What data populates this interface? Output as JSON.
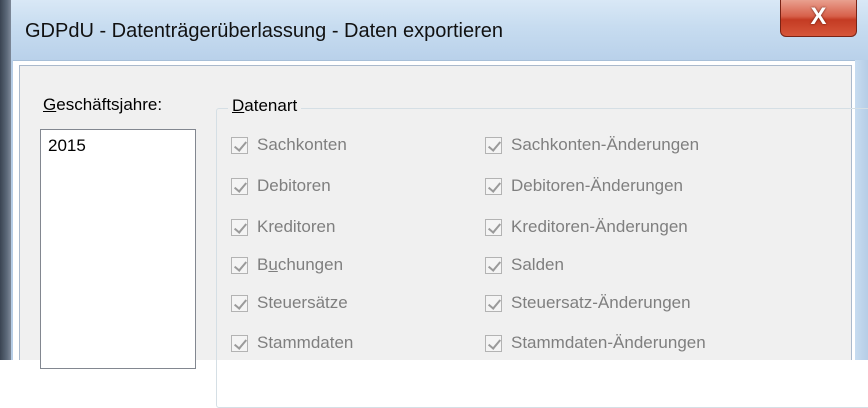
{
  "window": {
    "title": "GDPdU - Datenträgerüberlassung - Daten exportieren",
    "close_label": "X"
  },
  "years": {
    "label_accel": "G",
    "label_rest": "eschäftsjahre:",
    "items": [
      "2015"
    ]
  },
  "datenart": {
    "title_accel": "D",
    "title_rest": "atenart",
    "left": [
      {
        "label": "Sachkonten",
        "checked": true,
        "enabled": false
      },
      {
        "label": "Debitoren",
        "checked": true,
        "enabled": false
      },
      {
        "label": "Kreditoren",
        "checked": true,
        "enabled": false
      },
      {
        "label_pre": "B",
        "label_accel": "u",
        "label_rest": "chungen",
        "checked": true,
        "enabled": false
      },
      {
        "label": "Steuersätze",
        "checked": true,
        "enabled": false
      },
      {
        "label": "Stammdaten",
        "checked": true,
        "enabled": false
      }
    ],
    "right": [
      {
        "label": "Sachkonten-Änderungen",
        "checked": true,
        "enabled": false
      },
      {
        "label": "Debitoren-Änderungen",
        "checked": true,
        "enabled": false
      },
      {
        "label": "Kreditoren-Änderungen",
        "checked": true,
        "enabled": false
      },
      {
        "label": "Salden",
        "checked": true,
        "enabled": false
      },
      {
        "label": "Steuersatz-Änderungen",
        "checked": true,
        "enabled": false
      },
      {
        "label": "Stammdaten-Änderungen",
        "checked": true,
        "enabled": false
      }
    ]
  }
}
